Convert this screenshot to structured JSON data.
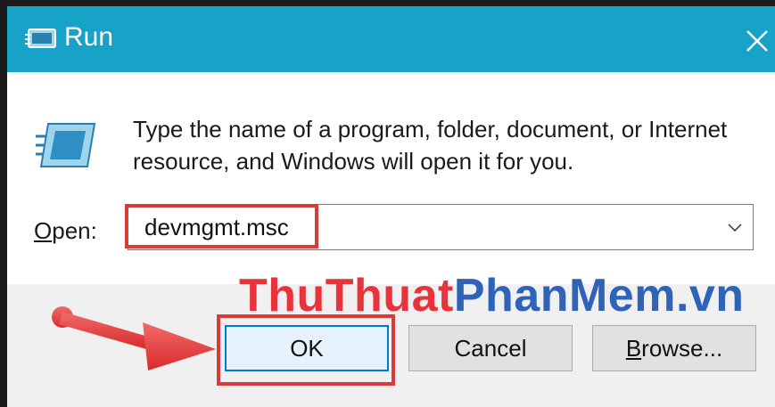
{
  "window": {
    "title": "Run",
    "icons": {
      "title": "run-icon",
      "close": "close-icon",
      "app": "run-program-icon",
      "dropdown": "chevron-down-icon"
    }
  },
  "dialog": {
    "description_line1": "Type the name of a program, folder, document, or Internet",
    "description_line2": "resource, and Windows will open it for you.",
    "open_label_mnemonic": "O",
    "open_label_rest": "pen:",
    "open_value": "devmgmt.msc"
  },
  "buttons": {
    "ok": "OK",
    "cancel": "Cancel",
    "browse_mnemonic": "B",
    "browse_rest": "rowse..."
  },
  "watermark": {
    "part1": "ThuThuat",
    "part2": "PhanMem",
    "part3": ".vn"
  },
  "colors": {
    "titlebar": "#17a2c8",
    "highlight": "#d93a3a",
    "focus": "#0078d7"
  }
}
